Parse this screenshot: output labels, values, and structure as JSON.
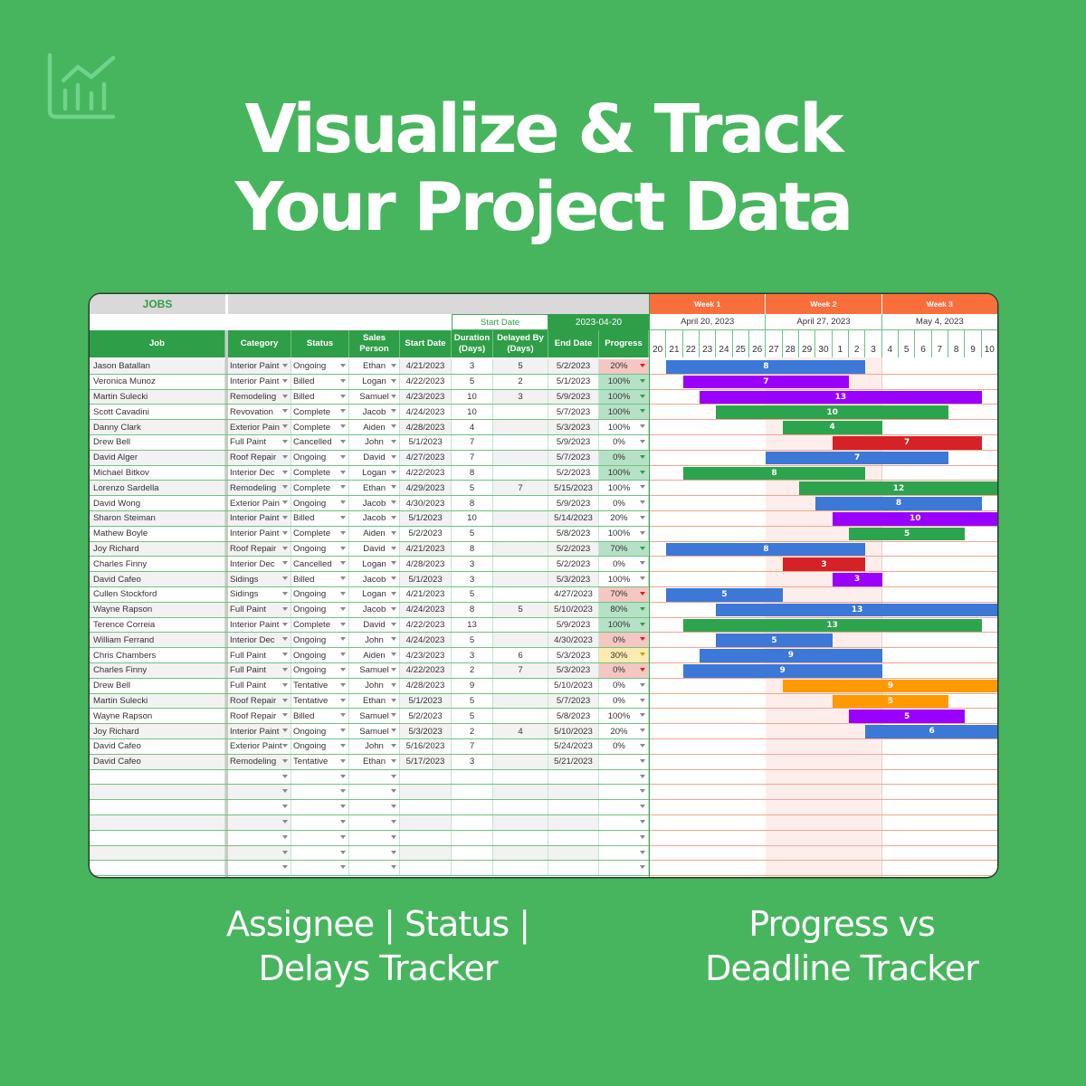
{
  "brand": {
    "logo_icon": "chart-line-bar-icon"
  },
  "headline": {
    "line1": "Visualize & Track",
    "line2": "Your Project Data"
  },
  "sheet": {
    "section_title": "JOBS",
    "start_date_label": "Start Date",
    "start_date_value": "2023-04-20",
    "columns": {
      "job": "Job",
      "category": "Category",
      "status": "Status",
      "sales_person": "Sales Person",
      "start_date": "Start Date",
      "duration": "Duration (Days)",
      "delayed_by": "Delayed By (Days)",
      "end_date": "End Date",
      "progress": "Progress"
    },
    "rows": [
      {
        "job": "Jason Batallan",
        "category": "Interior Paint",
        "status": "Ongoing",
        "sales": "Ethan",
        "start": "4/21/2023",
        "duration": "3",
        "delay": "5",
        "end": "5/2/2023",
        "progress": "20%",
        "prog_state": "red"
      },
      {
        "job": "Veronica Munoz",
        "category": "Interior Paint",
        "status": "Billed",
        "sales": "Logan",
        "start": "4/22/2023",
        "duration": "5",
        "delay": "2",
        "end": "5/1/2023",
        "progress": "100%",
        "prog_state": "green"
      },
      {
        "job": "Martin Sulecki",
        "category": "Remodeling",
        "status": "Billed",
        "sales": "Samuel",
        "start": "4/23/2023",
        "duration": "10",
        "delay": "3",
        "end": "5/9/2023",
        "progress": "100%",
        "prog_state": "green"
      },
      {
        "job": "Scott Cavadini",
        "category": "Revovation",
        "status": "Complete",
        "sales": "Jacob",
        "start": "4/24/2023",
        "duration": "10",
        "delay": "",
        "end": "5/7/2023",
        "progress": "100%",
        "prog_state": "green"
      },
      {
        "job": "Danny Clark",
        "category": "Exterior Pain",
        "status": "Complete",
        "sales": "Aiden",
        "start": "4/28/2023",
        "duration": "4",
        "delay": "",
        "end": "5/3/2023",
        "progress": "100%",
        "prog_state": "none"
      },
      {
        "job": "Drew Bell",
        "category": "Full Paint",
        "status": "Cancelled",
        "sales": "John",
        "start": "5/1/2023",
        "duration": "7",
        "delay": "",
        "end": "5/9/2023",
        "progress": "0%",
        "prog_state": "none"
      },
      {
        "job": "David Alger",
        "category": "Roof Repair",
        "status": "Ongoing",
        "sales": "David",
        "start": "4/27/2023",
        "duration": "7",
        "delay": "",
        "end": "5/7/2023",
        "progress": "0%",
        "prog_state": "green"
      },
      {
        "job": "Michael Bitkov",
        "category": "Interior Dec",
        "status": "Complete",
        "sales": "Logan",
        "start": "4/22/2023",
        "duration": "8",
        "delay": "",
        "end": "5/2/2023",
        "progress": "100%",
        "prog_state": "green"
      },
      {
        "job": "Lorenzo Sardella",
        "category": "Remodeling",
        "status": "Complete",
        "sales": "Ethan",
        "start": "4/29/2023",
        "duration": "5",
        "delay": "7",
        "end": "5/15/2023",
        "progress": "100%",
        "prog_state": "none"
      },
      {
        "job": "David Wong",
        "category": "Exterior Pain",
        "status": "Ongoing",
        "sales": "Jacob",
        "start": "4/30/2023",
        "duration": "8",
        "delay": "",
        "end": "5/9/2023",
        "progress": "0%",
        "prog_state": "none"
      },
      {
        "job": "Sharon Steiman",
        "category": "Interior Paint",
        "status": "Billed",
        "sales": "Jacob",
        "start": "5/1/2023",
        "duration": "10",
        "delay": "",
        "end": "5/14/2023",
        "progress": "20%",
        "prog_state": "none"
      },
      {
        "job": "Mathew Boyle",
        "category": "Interior Paint",
        "status": "Complete",
        "sales": "Aiden",
        "start": "5/2/2023",
        "duration": "5",
        "delay": "",
        "end": "5/8/2023",
        "progress": "100%",
        "prog_state": "none"
      },
      {
        "job": "Joy Richard",
        "category": "Roof Repair",
        "status": "Ongoing",
        "sales": "David",
        "start": "4/21/2023",
        "duration": "8",
        "delay": "",
        "end": "5/2/2023",
        "progress": "70%",
        "prog_state": "green"
      },
      {
        "job": "Charles Finny",
        "category": "Interior Dec",
        "status": "Cancelled",
        "sales": "Logan",
        "start": "4/28/2023",
        "duration": "3",
        "delay": "",
        "end": "5/2/2023",
        "progress": "0%",
        "prog_state": "none"
      },
      {
        "job": "David Cafeo",
        "category": "Sidings",
        "status": "Billed",
        "sales": "Jacob",
        "start": "5/1/2023",
        "duration": "3",
        "delay": "",
        "end": "5/3/2023",
        "progress": "100%",
        "prog_state": "none"
      },
      {
        "job": "Cullen Stockford",
        "category": "Sidings",
        "status": "Ongoing",
        "sales": "Logan",
        "start": "4/21/2023",
        "duration": "5",
        "delay": "",
        "end": "4/27/2023",
        "progress": "70%",
        "prog_state": "red"
      },
      {
        "job": "Wayne Rapson",
        "category": "Full Paint",
        "status": "Ongoing",
        "sales": "Jacob",
        "start": "4/24/2023",
        "duration": "8",
        "delay": "5",
        "end": "5/10/2023",
        "progress": "80%",
        "prog_state": "green"
      },
      {
        "job": "Terence Correia",
        "category": "Interior Paint",
        "status": "Complete",
        "sales": "David",
        "start": "4/22/2023",
        "duration": "13",
        "delay": "",
        "end": "5/9/2023",
        "progress": "100%",
        "prog_state": "green"
      },
      {
        "job": "William Ferrand",
        "category": "Interior Dec",
        "status": "Ongoing",
        "sales": "John",
        "start": "4/24/2023",
        "duration": "5",
        "delay": "",
        "end": "4/30/2023",
        "progress": "0%",
        "prog_state": "red"
      },
      {
        "job": "Chris Chambers",
        "category": "Full Paint",
        "status": "Ongoing",
        "sales": "Aiden",
        "start": "4/23/2023",
        "duration": "3",
        "delay": "6",
        "end": "5/3/2023",
        "progress": "30%",
        "prog_state": "yellow"
      },
      {
        "job": "Charles Finny",
        "category": "Full Paint",
        "status": "Ongoing",
        "sales": "Samuel",
        "start": "4/22/2023",
        "duration": "2",
        "delay": "7",
        "end": "5/3/2023",
        "progress": "0%",
        "prog_state": "red"
      },
      {
        "job": "Drew Bell",
        "category": "Full Paint",
        "status": "Tentative",
        "sales": "John",
        "start": "4/28/2023",
        "duration": "9",
        "delay": "",
        "end": "5/10/2023",
        "progress": "0%",
        "prog_state": "none"
      },
      {
        "job": "Martin Sulecki",
        "category": "Roof Repair",
        "status": "Tentative",
        "sales": "Ethan",
        "start": "5/1/2023",
        "duration": "5",
        "delay": "",
        "end": "5/7/2023",
        "progress": "0%",
        "prog_state": "none"
      },
      {
        "job": "Wayne Rapson",
        "category": "Roof Repair",
        "status": "Billed",
        "sales": "Samuel",
        "start": "5/2/2023",
        "duration": "5",
        "delay": "",
        "end": "5/8/2023",
        "progress": "100%",
        "prog_state": "none"
      },
      {
        "job": "Joy Richard",
        "category": "Interior Paint",
        "status": "Ongoing",
        "sales": "Samuel",
        "start": "5/3/2023",
        "duration": "2",
        "delay": "4",
        "end": "5/10/2023",
        "progress": "20%",
        "prog_state": "none"
      },
      {
        "job": "David Cafeo",
        "category": "Exterior Paint",
        "status": "Ongoing",
        "sales": "John",
        "start": "5/16/2023",
        "duration": "7",
        "delay": "",
        "end": "5/24/2023",
        "progress": "0%",
        "prog_state": "none"
      },
      {
        "job": "David Cafeo",
        "category": "Remodeling",
        "status": "Tentative",
        "sales": "Ethan",
        "start": "5/17/2023",
        "duration": "3",
        "delay": "",
        "end": "5/21/2023",
        "progress": "",
        "prog_state": "none"
      }
    ],
    "empty_rows": 7
  },
  "gantt": {
    "weeks": [
      {
        "label": "Week 1",
        "date": "April 20, 2023"
      },
      {
        "label": "Week 2",
        "date": "April 27, 2023"
      },
      {
        "label": "Week 3",
        "date": "May 4, 2023"
      }
    ],
    "days": [
      "20",
      "21",
      "22",
      "23",
      "24",
      "25",
      "26",
      "27",
      "28",
      "29",
      "30",
      "1",
      "2",
      "3",
      "4",
      "5",
      "6",
      "7",
      "8",
      "9",
      "10"
    ],
    "highlight_days": {
      "from": 7,
      "to": 13
    },
    "colors": {
      "blue": "#3c78d8",
      "purple": "#9900ff",
      "green": "#2ca44e",
      "red": "#d42226",
      "orange": "#ff9900"
    },
    "bars": [
      {
        "start": 1,
        "end": 13,
        "label": "8",
        "color": "blue"
      },
      {
        "start": 2,
        "end": 12,
        "label": "7",
        "color": "purple"
      },
      {
        "start": 3,
        "end": 20,
        "label": "13",
        "color": "purple"
      },
      {
        "start": 4,
        "end": 18,
        "label": "10",
        "color": "green"
      },
      {
        "start": 8,
        "end": 14,
        "label": "4",
        "color": "green"
      },
      {
        "start": 11,
        "end": 20,
        "label": "7",
        "color": "red"
      },
      {
        "start": 7,
        "end": 18,
        "label": "7",
        "color": "blue"
      },
      {
        "start": 2,
        "end": 13,
        "label": "8",
        "color": "green"
      },
      {
        "start": 9,
        "end": 21,
        "label": "12",
        "color": "green"
      },
      {
        "start": 10,
        "end": 20,
        "label": "8",
        "color": "blue"
      },
      {
        "start": 11,
        "end": 21,
        "label": "10",
        "color": "purple"
      },
      {
        "start": 12,
        "end": 19,
        "label": "5",
        "color": "green"
      },
      {
        "start": 1,
        "end": 13,
        "label": "8",
        "color": "blue"
      },
      {
        "start": 8,
        "end": 13,
        "label": "3",
        "color": "red"
      },
      {
        "start": 11,
        "end": 14,
        "label": "3",
        "color": "purple"
      },
      {
        "start": 1,
        "end": 8,
        "label": "5",
        "color": "blue"
      },
      {
        "start": 4,
        "end": 21,
        "label": "13",
        "color": "blue"
      },
      {
        "start": 2,
        "end": 20,
        "label": "13",
        "color": "green"
      },
      {
        "start": 4,
        "end": 11,
        "label": "5",
        "color": "blue"
      },
      {
        "start": 3,
        "end": 14,
        "label": "9",
        "color": "blue"
      },
      {
        "start": 2,
        "end": 14,
        "label": "9",
        "color": "blue"
      },
      {
        "start": 8,
        "end": 21,
        "label": "9",
        "color": "orange"
      },
      {
        "start": 11,
        "end": 18,
        "label": "5",
        "color": "orange"
      },
      {
        "start": 12,
        "end": 19,
        "label": "5",
        "color": "purple"
      },
      {
        "start": 13,
        "end": 21,
        "label": "6",
        "color": "blue"
      }
    ]
  },
  "captions": {
    "left_line1": "Assignee | Status |",
    "left_line2": "Delays Tracker",
    "right_line1": "Progress vs",
    "right_line2": "Deadline Tracker"
  }
}
